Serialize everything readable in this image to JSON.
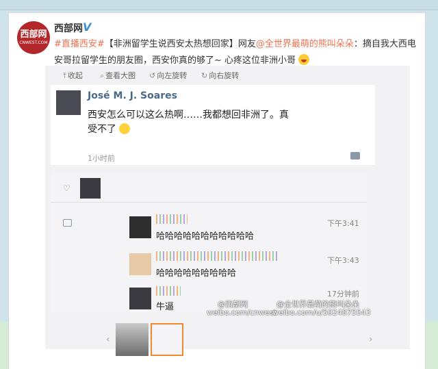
{
  "post": {
    "username": "西部网",
    "verified_badge": "V",
    "avatar_text": "西部网",
    "avatar_subtext": "CNWEST.COM",
    "hashtag": "#直播西安#",
    "headline": "【非洲留学生说西安太热想回家】",
    "text_prefix": "网友",
    "mention": "@全世界最萌的熊叫朵朵",
    "text_body": "：摘自我大西电安哥拉留学生的朋友圈，西安你真的够了~ 心疼这位非洲小哥"
  },
  "toolbar": {
    "collapse": "收起",
    "view_large": "查看大图",
    "rotate_left": "向左旋转",
    "rotate_right": "向右旋转"
  },
  "screenshot": {
    "author": "José M. J. Soares",
    "text": "西安怎么可以这么热啊……我都想回非洲了。真受不了",
    "time": "1小时前",
    "comments": [
      {
        "text": "哈哈哈哈哈哈哈哈哈哈哈",
        "time": "下午3:41"
      },
      {
        "text": "哈哈哈哈哈哈哈哈哈",
        "time": "下午3:43"
      },
      {
        "text": "牛逼",
        "time": "17分钟前"
      }
    ]
  },
  "watermarks": {
    "weibo_user_1": "@西部网",
    "weibo_url_1": "weibo.com/cnwest",
    "weibo_user_2": "@全世界最萌的熊叫朵朵",
    "weibo_url_2": "weibo.com/u/5024875543"
  },
  "colors": {
    "link": "#eb7350",
    "verified": "#3a8fd6",
    "avatar_bg": "#b3262a"
  }
}
